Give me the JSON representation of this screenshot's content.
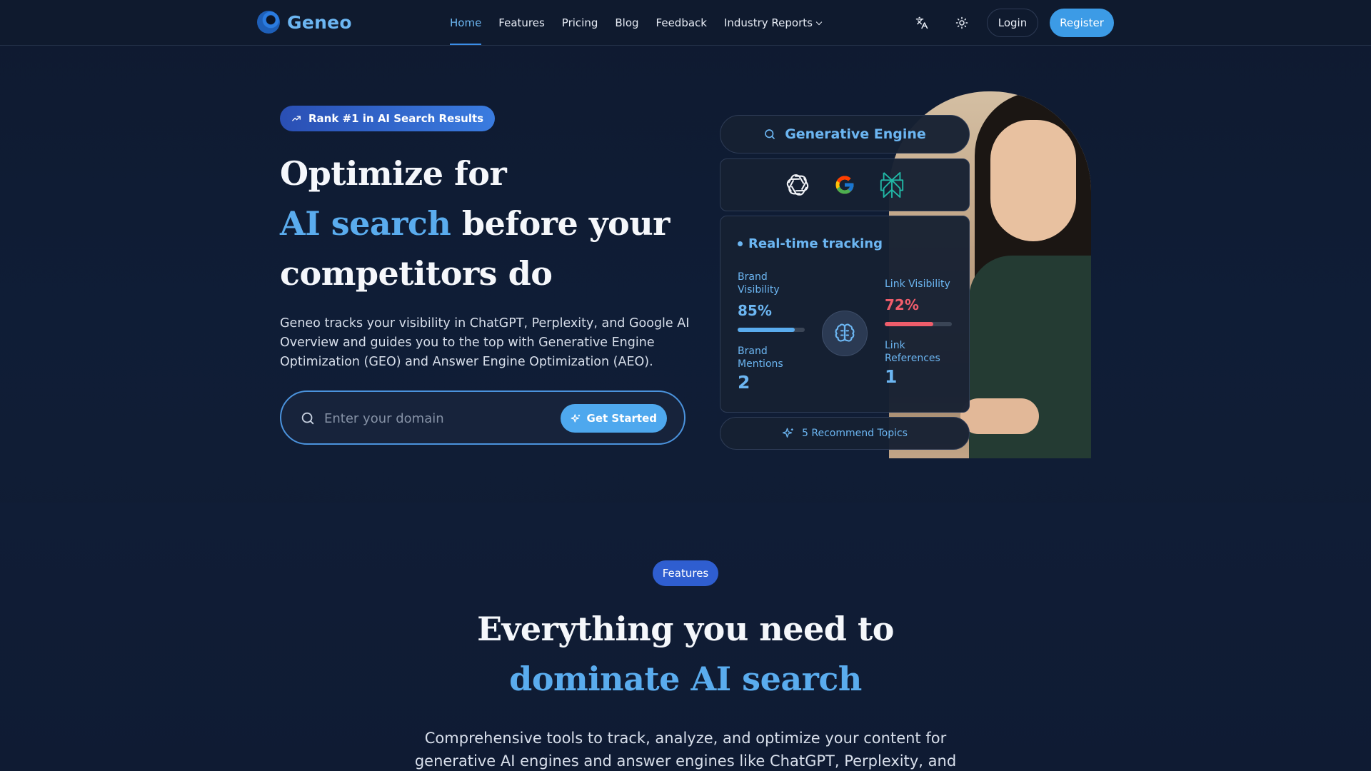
{
  "brand": {
    "name": "Geneo"
  },
  "nav": {
    "links": [
      {
        "label": "Home",
        "active": true
      },
      {
        "label": "Features"
      },
      {
        "label": "Pricing"
      },
      {
        "label": "Blog"
      },
      {
        "label": "Feedback"
      },
      {
        "label": "Industry Reports"
      }
    ],
    "login_label": "Login",
    "register_label": "Register"
  },
  "hero": {
    "badge": "Rank #1 in AI Search Results",
    "title_line1": "Optimize for",
    "title_accent": "AI search",
    "title_line2_rest": " before your",
    "title_line3": "competitors do",
    "description": "Geneo tracks your visibility in ChatGPT, Perplexity, and Google AI Overview and guides you to the top with Generative Engine Optimization (GEO) and Answer Engine Optimization (AEO).",
    "search_placeholder": "Enter your domain",
    "cta_label": "Get Started"
  },
  "dashboard": {
    "engine_label": "Generative Engine",
    "engines": [
      "chatgpt-icon",
      "google-icon",
      "perplexity-icon"
    ],
    "tracking_title": "Real-time tracking",
    "brand_visibility_label": "Brand Visibility",
    "brand_visibility_value": "85%",
    "brand_visibility_fraction": 0.85,
    "link_visibility_label": "Link Visibility",
    "link_visibility_value": "72%",
    "link_visibility_fraction": 0.72,
    "brand_mentions_label": "Brand Mentions",
    "brand_mentions_value": "2",
    "link_references_label": "Link References",
    "link_references_value": "1",
    "recommend_label": "5 Recommend Topics"
  },
  "colors": {
    "accent": "#5aacee",
    "primary_button": "#3c9be6",
    "danger": "#ef5d6b",
    "background": "#0f1a30"
  },
  "features": {
    "badge": "Features",
    "title_line1": "Everything you need to",
    "title_accent": "dominate AI search",
    "description": "Comprehensive tools to track, analyze, and optimize your content for generative AI engines and answer engines like ChatGPT, Perplexity, and"
  }
}
